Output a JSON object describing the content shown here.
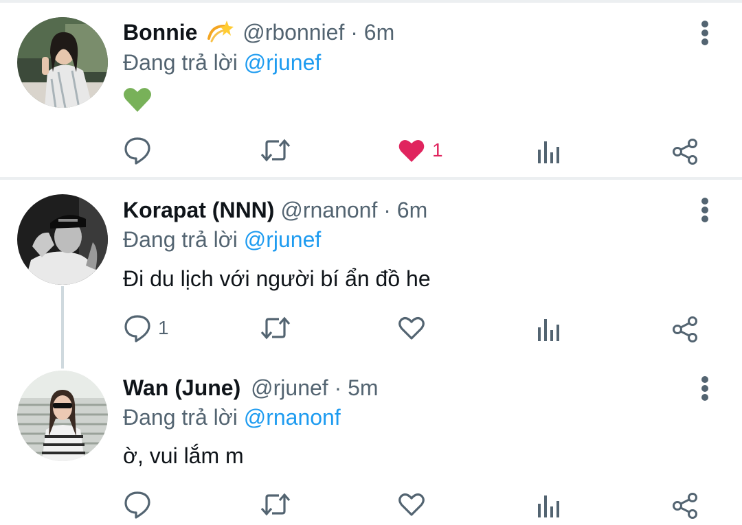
{
  "colors": {
    "accent": "#1d9bf0",
    "muted": "#536471",
    "like": "#e0245e",
    "text": "#0f1419"
  },
  "tweets": [
    {
      "name": "Bonnie",
      "badge_icon": "dizzy-emoji",
      "handle": "@rbonnief",
      "separator": "·",
      "time": "6m",
      "reply_prefix": "Đang trả lời",
      "reply_mention": "@rjunef",
      "text": "",
      "text_icon": "green-heart-emoji",
      "reply_count": "",
      "retweet_count": "",
      "like_count": "1",
      "liked": true
    },
    {
      "name": "Korapat (NNN)",
      "handle": "@rnanonf",
      "separator": "·",
      "time": "6m",
      "reply_prefix": "Đang trả lời",
      "reply_mention": "@rjunef",
      "text": "Đi du lịch với người bí ẩn đồ he",
      "reply_count": "1",
      "retweet_count": "",
      "like_count": "",
      "liked": false
    },
    {
      "name": "Wan (June)",
      "handle": "@rjunef",
      "separator": "·",
      "time": "5m",
      "reply_prefix": "Đang trả lời",
      "reply_mention": "@rnanonf",
      "text": "ờ, vui lắm m",
      "reply_count": "",
      "retweet_count": "",
      "like_count": "",
      "liked": false
    }
  ]
}
